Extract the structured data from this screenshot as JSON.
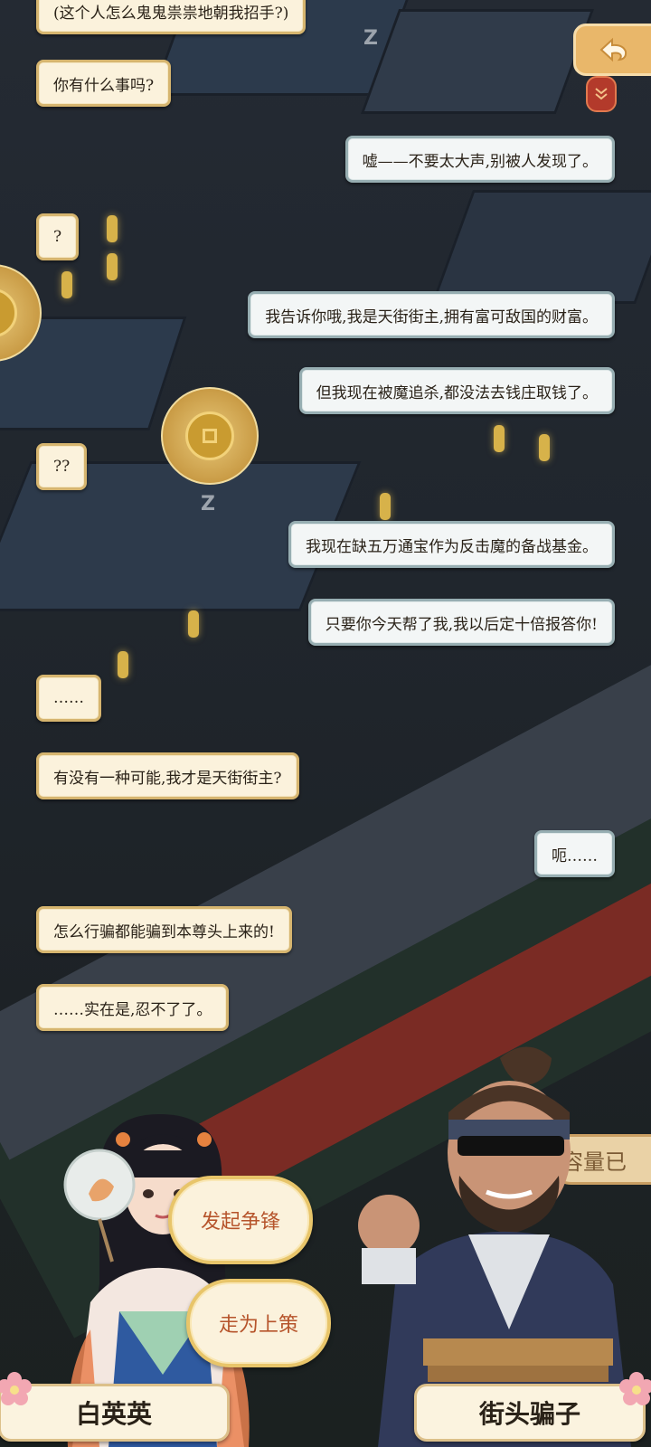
{
  "dialogue": [
    {
      "side": "left",
      "text": "(这个人怎么鬼鬼祟祟地朝我招手?)"
    },
    {
      "side": "left",
      "text": "你有什么事吗?"
    },
    {
      "side": "right",
      "text": "嘘——不要太大声,别被人发现了。"
    },
    {
      "side": "left",
      "text": "?"
    },
    {
      "side": "right",
      "text": "我告诉你哦,我是天街街主,拥有富可敌国的财富。"
    },
    {
      "side": "right",
      "text": "但我现在被魔追杀,都没法去钱庄取钱了。"
    },
    {
      "side": "left",
      "text": "??"
    },
    {
      "side": "right",
      "text": "我现在缺五万通宝作为反击魔的备战基金。"
    },
    {
      "side": "right",
      "text": "只要你今天帮了我,我以后定十倍报答你!"
    },
    {
      "side": "left",
      "text": "……"
    },
    {
      "side": "left",
      "text": "有没有一种可能,我才是天街街主?"
    },
    {
      "side": "right",
      "text": "呃……"
    },
    {
      "side": "left",
      "text": "怎么行骗都能骗到本尊头上来的!"
    },
    {
      "side": "left",
      "text": "……实在是,忍不了了。"
    }
  ],
  "choices": {
    "confront": "发起争锋",
    "flee": "走为上策"
  },
  "capacity_banner": "容量已",
  "names": {
    "left": "白英英",
    "right": "街头骗子"
  },
  "icons": {
    "back": "back-arrow-cloud-icon",
    "collapse": "double-chevron-down-icon",
    "coin": "copper-coin-icon",
    "flower": "plum-blossom-icon"
  },
  "colors": {
    "bubble_left_border": "#d6b56f",
    "bubble_right_border": "#97aeb2",
    "choice_text": "#b6542b",
    "back_button": "#e9b76a"
  }
}
